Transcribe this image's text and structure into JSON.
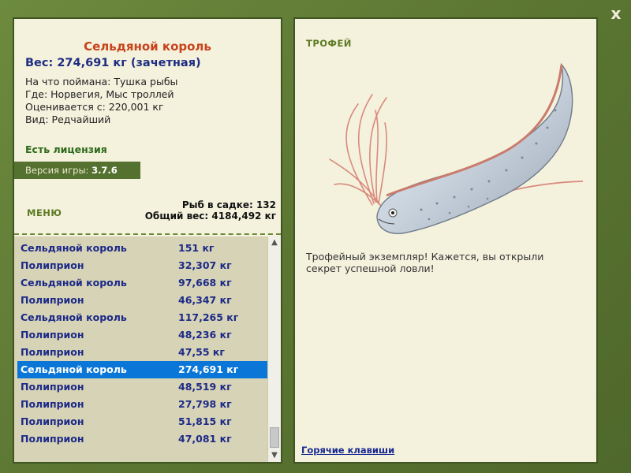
{
  "window": {
    "close_label": "x"
  },
  "catch": {
    "title": "Сельдяной король",
    "weight_line": "Вес: 274,691 кг (зачетная)",
    "info": [
      "На что поймана: Тушка рыбы",
      "Где: Норвегия, Мыс троллей",
      "Оценивается с: 220,001 кг",
      "Вид: Редчайший"
    ],
    "license": "Есть лицензия"
  },
  "version": {
    "label": "Версия игры:",
    "value": "3.7.6"
  },
  "menu_label": "МЕНЮ",
  "keepnet": {
    "count_line": "Рыб в садке: 132",
    "total_line": "Общий вес: 4184,492 кг"
  },
  "fish_list": [
    {
      "name": "Сельдяной король",
      "weight": "151 кг"
    },
    {
      "name": "Полиприон",
      "weight": "32,307 кг"
    },
    {
      "name": "Сельдяной король",
      "weight": "97,668 кг"
    },
    {
      "name": "Полиприон",
      "weight": "46,347 кг"
    },
    {
      "name": "Сельдяной король",
      "weight": "117,265 кг"
    },
    {
      "name": "Полиприон",
      "weight": "48,236 кг"
    },
    {
      "name": "Полиприон",
      "weight": "47,55 кг"
    },
    {
      "name": "Сельдяной король",
      "weight": "274,691 кг",
      "selected": true
    },
    {
      "name": "Полиприон",
      "weight": "48,519 кг"
    },
    {
      "name": "Полиприон",
      "weight": "27,798 кг"
    },
    {
      "name": "Полиприон",
      "weight": "51,815 кг"
    },
    {
      "name": "Полиприон",
      "weight": "47,081 кг"
    }
  ],
  "trophy": {
    "label": "ТРОФЕЙ",
    "text": "Трофейный экземпляр! Кажется, вы открыли секрет успешной ловли!",
    "image_icon": "oarfish-image"
  },
  "hotkeys_label": "Горячие клавиши",
  "colors": {
    "frame": "#5e7a35",
    "panel": "#f4f1dd",
    "title": "#c8421a",
    "list_text": "#1c2a88",
    "selection": "#0a77d8"
  }
}
